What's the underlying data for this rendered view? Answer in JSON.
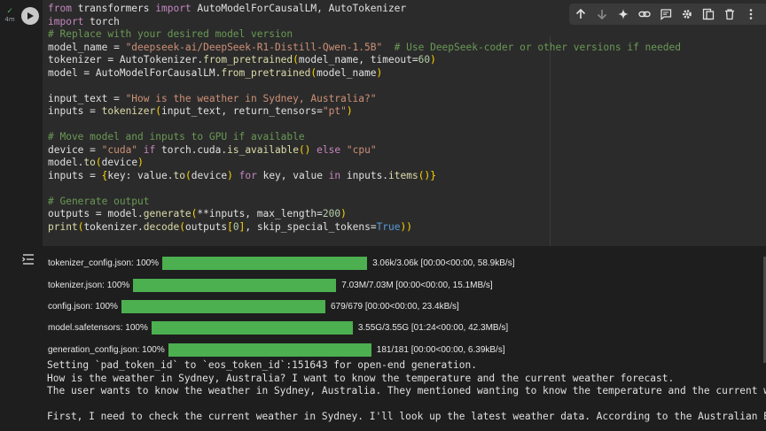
{
  "run_status": {
    "check": "✓",
    "elapsed": "4m"
  },
  "code_lines": [
    "from transformers import AutoModelForCausalLM, AutoTokenizer",
    "import torch",
    "# Replace with your desired model version",
    "model_name = \"deepseek-ai/DeepSeek-R1-Distill-Qwen-1.5B\"  # Use DeepSeek-coder or other versions if needed",
    "tokenizer = AutoTokenizer.from_pretrained(model_name, timeout=60)",
    "model = AutoModelForCausalLM.from_pretrained(model_name)",
    "",
    "input_text = \"How is the weather in Sydney, Australia?\"",
    "inputs = tokenizer(input_text, return_tensors=\"pt\")",
    "",
    "# Move model and inputs to GPU if available",
    "device = \"cuda\" if torch.cuda.is_available() else \"cpu\"",
    "model.to(device)",
    "inputs = {key: value.to(device) for key, value in inputs.items()}",
    "",
    "# Generate output",
    "outputs = model.generate(**inputs, max_length=200)",
    "print(tokenizer.decode(outputs[0], skip_special_tokens=True))"
  ],
  "toolbar_icons": [
    "arrow-up-icon",
    "arrow-down-icon",
    "sparkle-icon",
    "link-icon",
    "comment-icon",
    "gear-icon",
    "mirror-cell-icon",
    "delete-icon",
    "more-icon"
  ],
  "progress_bars": [
    {
      "label": "tokenizer_config.json: 100%",
      "fraction": 1.0,
      "stats": "3.06k/3.06k [00:00<00:00, 58.9kB/s]"
    },
    {
      "label": "tokenizer.json: 100%",
      "fraction": 1.0,
      "stats": "7.03M/7.03M [00:00<00:00, 15.1MB/s]"
    },
    {
      "label": "config.json: 100%",
      "fraction": 1.0,
      "stats": "679/679 [00:00<00:00, 23.4kB/s]"
    },
    {
      "label": "model.safetensors: 100%",
      "fraction": 1.0,
      "stats": "3.55G/3.55G [01:24<00:00, 42.3MB/s]"
    },
    {
      "label": "generation_config.json: 100%",
      "fraction": 1.0,
      "stats": "181/181 [00:00<00:00, 6.39kB/s]"
    }
  ],
  "output_text": [
    "Setting `pad_token_id` to `eos_token_id`:151643 for open-end generation.",
    "How is the weather in Sydney, Australia? I want to know the temperature and the current weather forecast.",
    "The user wants to know the weather in Sydney, Australia. They mentioned wanting to know the temperature and the current weathe",
    "",
    "First, I need to check the current weather in Sydney. I'll look up the latest weather data. According to the Australian Bureau"
  ],
  "colors": {
    "progress_fill": "#4caf50",
    "cell_bg": "#2b2b2b",
    "comment": "#6a9955",
    "string": "#ce9178",
    "keyword": "#c586c0"
  }
}
